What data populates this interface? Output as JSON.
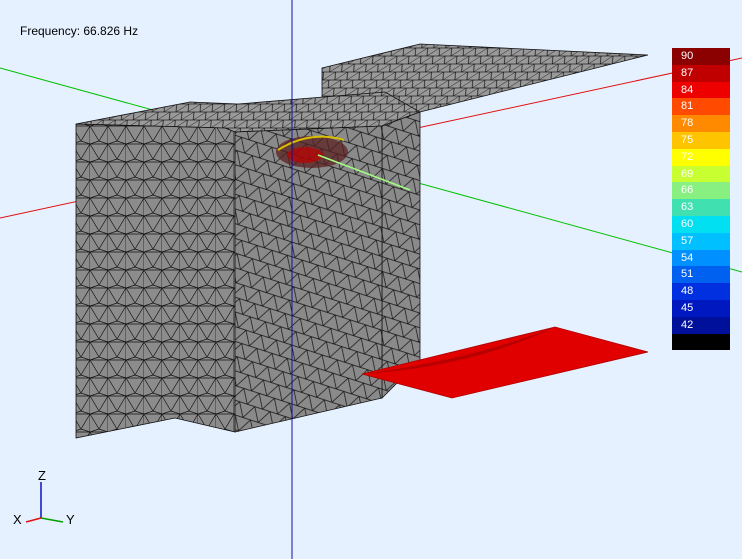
{
  "viewport": {
    "frequency_label": "Frequency: 66.826 Hz",
    "background": "#e6f1ff"
  },
  "legend": {
    "entries": [
      {
        "value": "90",
        "color": "#8b0000"
      },
      {
        "value": "87",
        "color": "#c00000"
      },
      {
        "value": "84",
        "color": "#ee0000"
      },
      {
        "value": "81",
        "color": "#ff4a00"
      },
      {
        "value": "78",
        "color": "#ff8a00"
      },
      {
        "value": "75",
        "color": "#ffc400"
      },
      {
        "value": "72",
        "color": "#ffff00"
      },
      {
        "value": "69",
        "color": "#c8ff30"
      },
      {
        "value": "66",
        "color": "#88f080"
      },
      {
        "value": "63",
        "color": "#40e0b0"
      },
      {
        "value": "60",
        "color": "#00e0f0"
      },
      {
        "value": "57",
        "color": "#00c0ff"
      },
      {
        "value": "54",
        "color": "#0090ff"
      },
      {
        "value": "51",
        "color": "#0060f0"
      },
      {
        "value": "48",
        "color": "#0030e0"
      },
      {
        "value": "45",
        "color": "#0018c0"
      },
      {
        "value": "42",
        "color": "#00109a"
      },
      {
        "value": "",
        "color": "#000000"
      }
    ]
  },
  "triad": {
    "z_label": "Z",
    "x_label": "X",
    "y_label": "Y"
  },
  "colors": {
    "mesh_fill": "#8c8c8c",
    "mesh_line": "#111111",
    "surface_red": "#e00000",
    "axis_red": "#e01010",
    "axis_green": "#00c000",
    "axis_blue": "#1010a0"
  }
}
